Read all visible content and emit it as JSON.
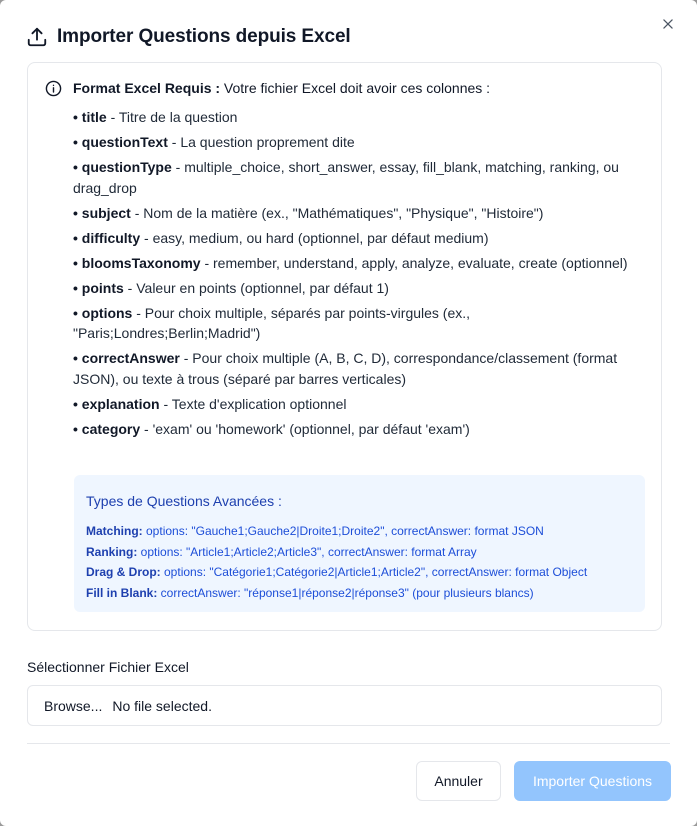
{
  "dialog": {
    "title": "Importer Questions depuis Excel",
    "upload_icon": "upload-icon",
    "close_icon": "close-icon"
  },
  "info": {
    "icon": "info-icon",
    "intro_bold": "Format Excel Requis :",
    "intro_text": " Votre fichier Excel doit avoir ces colonnes :",
    "columns": [
      {
        "name": "title",
        "desc": " - Titre de la question"
      },
      {
        "name": "questionText",
        "desc": " - La question proprement dite"
      },
      {
        "name": "questionType",
        "desc": " - multiple_choice, short_answer, essay, fill_blank, matching, ranking, ou drag_drop"
      },
      {
        "name": "subject",
        "desc": " - Nom de la matière (ex., \"Mathématiques\", \"Physique\", \"Histoire\")"
      },
      {
        "name": "difficulty",
        "desc": " - easy, medium, ou hard (optionnel, par défaut medium)"
      },
      {
        "name": "bloomsTaxonomy",
        "desc": " - remember, understand, apply, analyze, evaluate, create (optionnel)"
      },
      {
        "name": "points",
        "desc": " - Valeur en points (optionnel, par défaut 1)"
      },
      {
        "name": "options",
        "desc": " - Pour choix multiple, séparés par points-virgules (ex., \"Paris;Londres;Berlin;Madrid\")"
      },
      {
        "name": "correctAnswer",
        "desc": " - Pour choix multiple (A, B, C, D), correspondance/classement (format JSON), ou texte à trous (séparé par barres verticales)"
      },
      {
        "name": "explanation",
        "desc": " - Texte d'explication optionnel"
      },
      {
        "name": "category",
        "desc": " - 'exam' ou 'homework' (optionnel, par défaut 'exam')"
      }
    ],
    "advanced": {
      "title": "Types de Questions Avancées :",
      "lines": [
        {
          "key": "Matching:",
          "text": " options: \"Gauche1;Gauche2|Droite1;Droite2\", correctAnswer: format JSON"
        },
        {
          "key": "Ranking:",
          "text": " options: \"Article1;Article2;Article3\", correctAnswer: format Array"
        },
        {
          "key": "Drag & Drop:",
          "text": " options: \"Catégorie1;Catégorie2|Article1;Article2\", correctAnswer: format Object"
        },
        {
          "key": "Fill in Blank:",
          "text": " correctAnswer: \"réponse1|réponse2|réponse3\" (pour plusieurs blancs)"
        }
      ]
    }
  },
  "file": {
    "label": "Sélectionner Fichier Excel",
    "browse_label": "Browse...",
    "status": "No file selected."
  },
  "footer": {
    "cancel_label": "Annuler",
    "import_label": "Importer Questions"
  },
  "colors": {
    "accent_disabled": "#93c5fd",
    "advanced_bg": "#eff6ff",
    "advanced_text": "#1d4ed8"
  }
}
